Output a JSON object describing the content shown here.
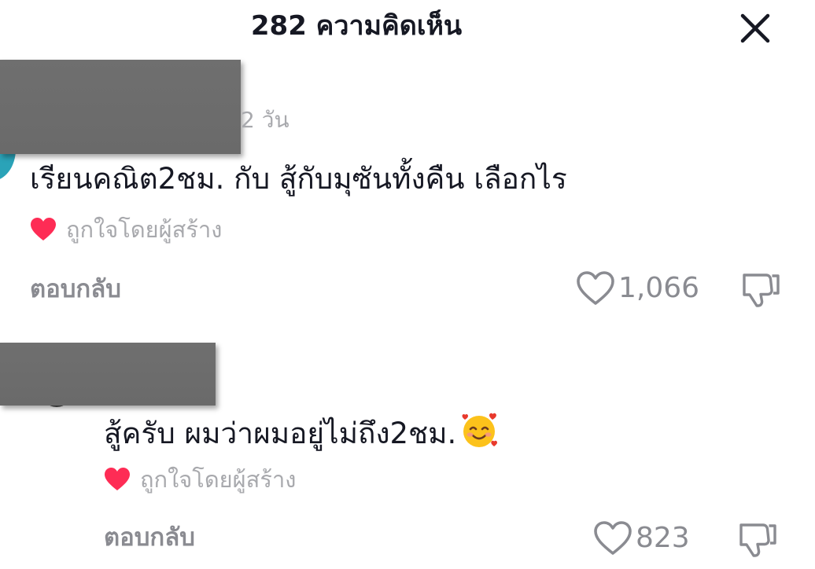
{
  "header": {
    "title": "282 ความคิดเห็น",
    "close_icon": "close-icon"
  },
  "comments": [
    {
      "timestamp": "2 วัน",
      "text": "เรียนคณิต2ชม. กับ สู้กับมุซันทั้งคืน เลือกไร",
      "liked_by_creator": "ถูกใจโดยผู้สร้าง",
      "reply_label": "ตอบกลับ",
      "like_count": "1,066"
    },
    {
      "text": "สู้ครับ ผมว่าผมอยู่ไม่ถึง2ชม.",
      "emoji": "smiling-face-with-hearts-emoji",
      "liked_by_creator": "ถูกใจโดยผู้สร้าง",
      "reply_label": "ตอบกลับ",
      "like_count": "823"
    }
  ],
  "colors": {
    "text_primary": "#161823",
    "text_secondary": "#a8a9ad",
    "icon_gray": "#8a8b91",
    "creator_heart": "#fe2c55",
    "redaction": "#6e6e6e"
  }
}
